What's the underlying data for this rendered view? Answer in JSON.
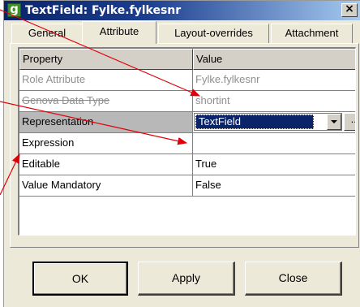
{
  "window": {
    "title": "TextField: Fylke.fylkesnr",
    "app_icon_glyph": "g",
    "close_glyph": "×"
  },
  "tabs": [
    {
      "label": "General",
      "active": false
    },
    {
      "label": "Attribute",
      "active": true
    },
    {
      "label": "Layout-overrides",
      "active": false
    },
    {
      "label": "Attachment",
      "active": false
    }
  ],
  "grid": {
    "headers": {
      "property": "Property",
      "value": "Value"
    },
    "rows": [
      {
        "property": "Role Attribute",
        "value": "Fylke.fylkesnr",
        "state": "disabled"
      },
      {
        "property": "Genova Data Type",
        "value": "shortint",
        "state": "disabled"
      },
      {
        "property": "Representation",
        "value": "TextField",
        "state": "editing"
      },
      {
        "property": "Expression",
        "value": "",
        "state": "normal"
      },
      {
        "property": "Editable",
        "value": "True",
        "state": "normal"
      },
      {
        "property": "Value Mandatory",
        "value": "False",
        "state": "normal"
      }
    ],
    "ellipsis_label": "..."
  },
  "buttons": {
    "ok": "OK",
    "apply": "Apply",
    "close": "Close"
  },
  "colors": {
    "title_gradient_start": "#0a246a",
    "title_gradient_end": "#a6caf0",
    "selection": "#0a246a",
    "dialog_face": "#ece9d8",
    "annotation_arrow": "#e0000a"
  },
  "icons": {
    "app": "genova-g-icon",
    "close": "close-icon",
    "dropdown": "chevron-down-icon"
  }
}
